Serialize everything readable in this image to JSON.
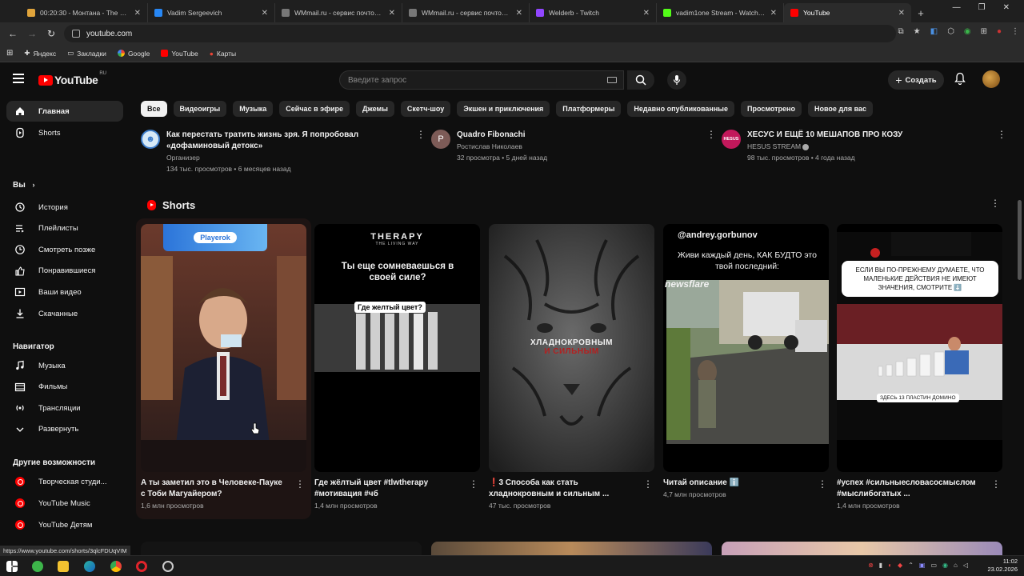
{
  "browser": {
    "tabs": [
      {
        "label": "00:20:30 - Монтана - The West",
        "favicon_color": "#e0a43b"
      },
      {
        "label": "Vadim Sergeevich",
        "favicon_color": "#2787f5"
      },
      {
        "label": "WMmail.ru - сервис почтовых",
        "favicon_color": "#777777"
      },
      {
        "label": "WMmail.ru - сервис почтовых",
        "favicon_color": "#777777"
      },
      {
        "label": "Welderb - Twitch",
        "favicon_color": "#9146ff"
      },
      {
        "label": "vadim1one Stream - Watch Liv",
        "favicon_color": "#53fc18"
      },
      {
        "label": "YouTube",
        "favicon_color": "#ff0000"
      }
    ],
    "url": "youtube.com",
    "bookmarks": [
      "Яндекс",
      "Закладки",
      "Google",
      "YouTube",
      "Карты"
    ],
    "status_url": "https://www.youtube.com/shorts/3qlcFDUqVIM"
  },
  "header": {
    "logo_text": "YouTube",
    "logo_region": "RU",
    "search_placeholder": "Введите запрос",
    "create_label": "Создать"
  },
  "sidebar": {
    "main": [
      {
        "label": "Главная",
        "icon": "home-icon"
      },
      {
        "label": "Shorts",
        "icon": "shorts-icon"
      }
    ],
    "you_heading": "Вы",
    "you": [
      {
        "label": "История",
        "icon": "history-icon"
      },
      {
        "label": "Плейлисты",
        "icon": "playlist-icon"
      },
      {
        "label": "Смотреть позже",
        "icon": "clock-icon"
      },
      {
        "label": "Понравившиеся",
        "icon": "thumbs-up-icon"
      },
      {
        "label": "Ваши видео",
        "icon": "video-icon"
      },
      {
        "label": "Скачанные",
        "icon": "download-icon"
      }
    ],
    "nav_heading": "Навигатор",
    "nav": [
      {
        "label": "Музыка",
        "icon": "music-icon"
      },
      {
        "label": "Фильмы",
        "icon": "film-icon"
      },
      {
        "label": "Трансляции",
        "icon": "live-icon"
      },
      {
        "label": "Развернуть",
        "icon": "chevron-down-icon"
      }
    ],
    "more_heading": "Другие возможности",
    "more": [
      {
        "label": "Творческая студи..."
      },
      {
        "label": "YouTube Music"
      },
      {
        "label": "YouTube Детям"
      }
    ]
  },
  "chips": [
    "Все",
    "Видеоигры",
    "Музыка",
    "Сейчас в эфире",
    "Джемы",
    "Скетч-шоу",
    "Экшен и приключения",
    "Платформеры",
    "Недавно опубликованные",
    "Просмотрено",
    "Новое для вас"
  ],
  "videos": [
    {
      "title_line1": "Как перестать тратить жизнь зря. Я попробовал",
      "title_line2": "«дофаминовый детокс»",
      "channel": "Организер",
      "stats": "134 тыс. просмотров • 6 месяцев назад"
    },
    {
      "title_line1": "Quadro Fibonachi",
      "title_line2": "",
      "channel": "Ростислав Николаев",
      "stats": "32 просмотра • 5 дней назад",
      "avatar_letter": "P"
    },
    {
      "title_line1": "ХЕСУС И ЕЩЁ 10 МЕШАПОВ ПРО КОЗУ",
      "title_line2": "",
      "channel": "HESUS STREAM",
      "stats": "98 тыс. просмотров • 4 года назад",
      "avatar_text": "HESUS"
    }
  ],
  "shorts_heading": "Shorts",
  "shorts": [
    {
      "title_line1": "А ты заметил это в Человеке-Пауке",
      "title_line2": "с Тоби Магуайером?",
      "views": "1,6 млн просмотров",
      "overlay_badge": "Playerok"
    },
    {
      "title_line1": "Где жёлтый цвет #tlwtherapy",
      "title_line2": "#мотивация #чб",
      "views": "1,4 млн просмотров",
      "overlay_brand": "THERAPY",
      "overlay_sub": "THE LIVING WAY",
      "overlay_q": "Ты еще сомневаешься в своей силе?",
      "overlay_tag": "Где желтый цвет?"
    },
    {
      "title_line1": "❗3 Способа как стать",
      "title_line2": "хладнокровным и сильным ...",
      "views": "47 тыс. просмотров",
      "overlay_text1": "ХЛАДНОКРОВНЫМ",
      "overlay_text2": "И СИЛЬНЫМ"
    },
    {
      "title_line1": "Читай описание ℹ️",
      "title_line2": "",
      "views": "4,7 млн просмотров",
      "overlay_handle": "@andrey.gorbunov",
      "overlay_text": "Живи каждый день, КАК БУДТО это твой последний:",
      "overlay_brand": "newsflare"
    },
    {
      "title_line1": "#успех #сильныесловасосмыслом",
      "title_line2": "#мыслибогатых ...",
      "views": "1,4 млн просмотров",
      "overlay_text": "ЕСЛИ ВЫ ПО-ПРЕЖНЕМУ ДУМАЕТЕ, ЧТО МАЛЕНЬКИЕ ДЕЙСТВИЯ НЕ ИМЕЮТ ЗНАЧЕНИЯ, СМОТРИТЕ ⬇️",
      "overlay_caption": "ЗДЕСЬ 13 ПЛАСТИН ДОМИНО"
    }
  ],
  "taskbar": {
    "time": "11:02",
    "date": "23.02.2026"
  }
}
